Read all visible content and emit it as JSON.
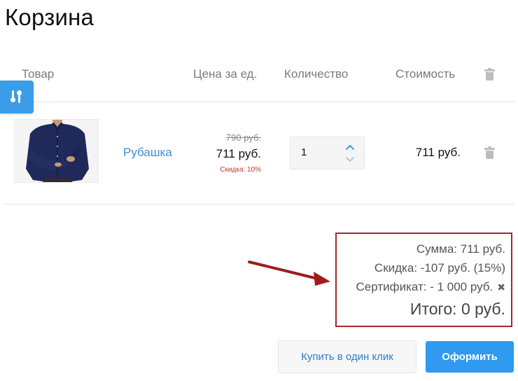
{
  "page": {
    "title": "Корзина"
  },
  "table_header": {
    "product": "Товар",
    "price": "Цена за ед.",
    "quantity": "Количество",
    "cost": "Стоимость"
  },
  "items": [
    {
      "name": "Рубашка",
      "old_price": "790 руб.",
      "price": "711 руб.",
      "discount": "Скидка: 10%",
      "quantity": "1",
      "cost": "711 руб."
    }
  ],
  "totals": {
    "sum": "Сумма: 711 руб.",
    "discount": "Скидка: -107 руб. (15%)",
    "certificate": "Сертификат: - 1 000 руб.",
    "total": "Итого: 0 руб."
  },
  "buttons": {
    "one_click": "Купить в один клик",
    "checkout": "Оформить"
  },
  "colors": {
    "accent": "#2f9af0",
    "link": "#3a8fd6",
    "discount": "#c0392b",
    "annotation": "#a52a2a"
  },
  "icons": {
    "trash": "trash-icon",
    "filter": "filter-icon",
    "up": "chevron-up-icon",
    "down": "chevron-down-icon",
    "remove": "close-icon"
  }
}
